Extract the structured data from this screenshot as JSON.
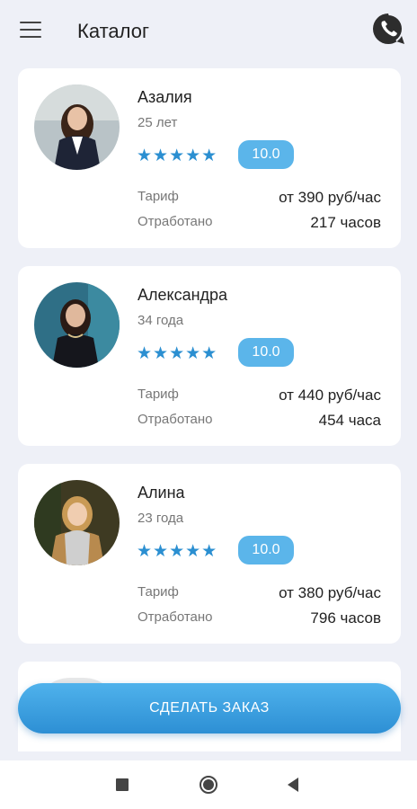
{
  "header": {
    "title": "Каталог",
    "menu_icon": "hamburger-menu-icon",
    "chat_icon": "whatsapp-icon"
  },
  "catalog": [
    {
      "name": "Азалия",
      "age": "25 лет",
      "stars": "★★★★★",
      "rating": "10.0",
      "tariff_label": "Тариф",
      "tariff_value": "от 390 руб/час",
      "worked_label": "Отработано",
      "worked_value": "217 часов"
    },
    {
      "name": "Александра",
      "age": "34 года",
      "stars": "★★★★★",
      "rating": "10.0",
      "tariff_label": "Тариф",
      "tariff_value": "от 440 руб/час",
      "worked_label": "Отработано",
      "worked_value": "454 часа"
    },
    {
      "name": "Алина",
      "age": "23 года",
      "stars": "★★★★★",
      "rating": "10.0",
      "tariff_label": "Тариф",
      "tariff_value": "от 380 руб/час",
      "worked_label": "Отработано",
      "worked_value": "796 часов"
    }
  ],
  "order_button": {
    "label": "СДЕЛАТЬ ЗАКАЗ"
  },
  "colors": {
    "accent": "#2d8fd4",
    "rating_badge": "#5bb5ea",
    "background": "#eef0f7"
  }
}
